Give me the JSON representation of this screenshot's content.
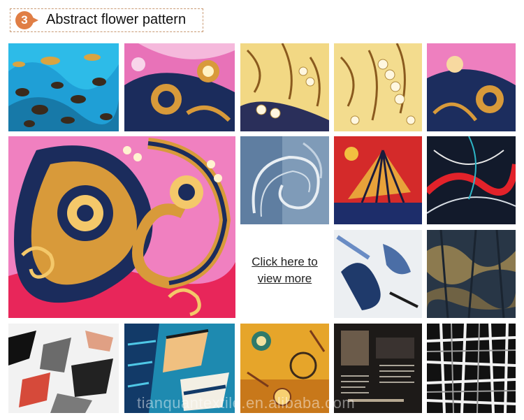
{
  "header": {
    "badge_number": "3",
    "title": "Abstract flower pattern",
    "accent_color": "#e07e45",
    "border_color": "#c99a74"
  },
  "cta": {
    "line1": "Click here to",
    "line2": "view more"
  },
  "watermark": "tianquantextile.en.alibaba.com"
}
